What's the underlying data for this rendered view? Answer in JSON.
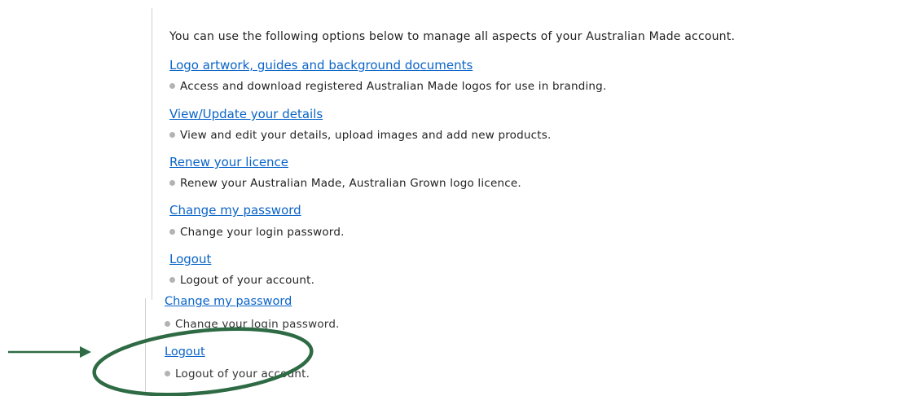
{
  "panel_main": {
    "intro": "You can use the following options below to manage all aspects of your Australian Made account.",
    "options": [
      {
        "link": "Logo artwork, guides and background documents",
        "desc": "Access and download registered Australian Made logos for use in branding."
      },
      {
        "link": "View/Update your details",
        "desc": "View and edit your details, upload images and add new products."
      },
      {
        "link": "Renew your licence",
        "desc": "Renew your Australian Made, Australian Grown logo licence."
      },
      {
        "link": "Change my password",
        "desc": "Change your login password."
      },
      {
        "link": "Logout",
        "desc": "Logout of your account."
      }
    ]
  },
  "panel_zoom": {
    "options": [
      {
        "link": "Change my password",
        "desc": "Change your login password."
      },
      {
        "link": "Logout",
        "desc": "Logout of your account."
      }
    ]
  },
  "annotation": {
    "color": "#2e6b45",
    "icons": [
      "arrow-right-icon",
      "highlight-ellipse"
    ]
  }
}
